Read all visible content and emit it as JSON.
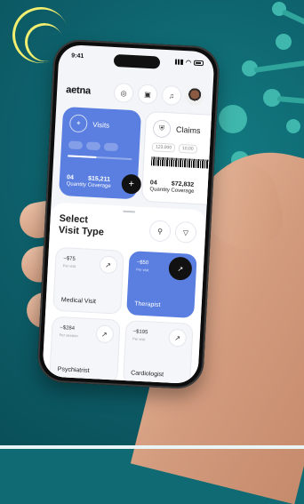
{
  "status": {
    "time": "9:41"
  },
  "header": {
    "logo": "aetna"
  },
  "visits_card": {
    "title": "Visits",
    "stat1_value": "04",
    "stat1_label": "Quantity",
    "stat2_value": "$15,211",
    "stat2_label": "Coverage"
  },
  "claims_card": {
    "title": "Claims",
    "chip1": "123,000",
    "chip2": "10,00",
    "stat1_value": "04",
    "stat1_label": "Quantity",
    "stat2_value": "$72,832",
    "stat2_label": "Coverage"
  },
  "sheet": {
    "title_line1": "Select",
    "title_line2": "Visit Type",
    "tiles": [
      {
        "price": "~$75",
        "note": "Per visit",
        "label": "Medical Visit"
      },
      {
        "price": "~$50",
        "note": "Per visit",
        "label": "Therapist"
      },
      {
        "price": "~$284",
        "note": "Per session",
        "label": "Psychiatrist"
      },
      {
        "price": "~$195",
        "note": "Per visit",
        "label": "Cardiologist"
      }
    ]
  },
  "icons": [
    "chat-icon",
    "calendar-icon",
    "bell-icon",
    "search-icon",
    "filter-icon",
    "arrow-up-right-icon",
    "location-pin-icon",
    "shield-icon"
  ],
  "colors": {
    "background": "#0f6a73",
    "accent": "#5b7fe0",
    "dots": "#3fb7ad",
    "arcs": "#f2ee6f"
  }
}
